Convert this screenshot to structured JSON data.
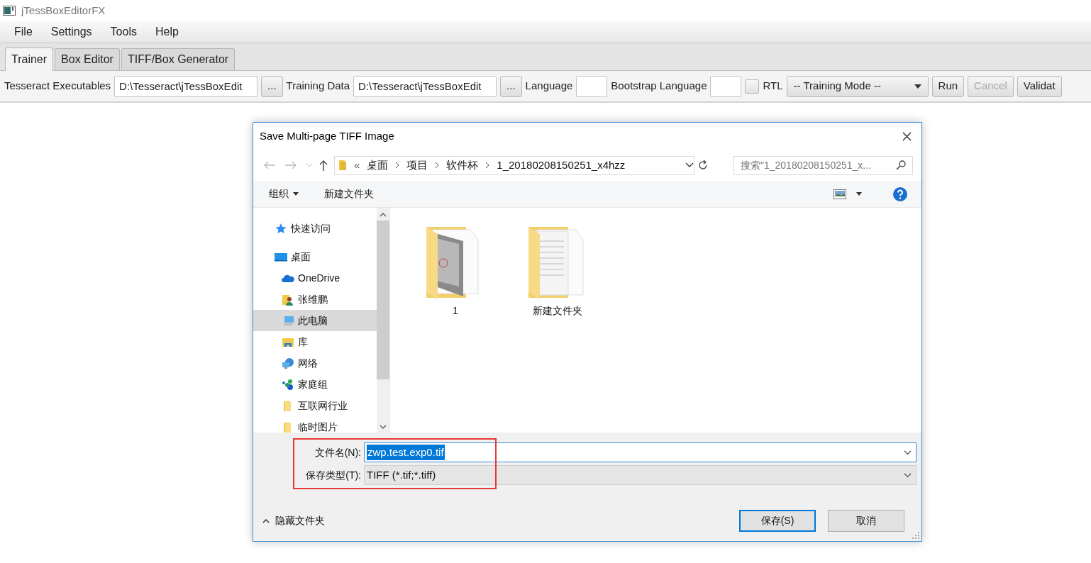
{
  "window": {
    "title": "jTessBoxEditorFX"
  },
  "menu": [
    "File",
    "Settings",
    "Tools",
    "Help"
  ],
  "tabs": [
    {
      "label": "Trainer",
      "selected": true
    },
    {
      "label": "Box Editor",
      "selected": false
    },
    {
      "label": "TIFF/Box Generator",
      "selected": false
    }
  ],
  "toolbar": [
    {
      "kind": "label",
      "text": "Tesseract Executables"
    },
    {
      "kind": "field",
      "value": "D:\\Tesseract\\jTessBoxEdit"
    },
    {
      "kind": "button",
      "text": "...",
      "disabled": false
    },
    {
      "kind": "label",
      "text": "Training Data"
    },
    {
      "kind": "field",
      "value": "D:\\Tesseract\\jTessBoxEdit"
    },
    {
      "kind": "button",
      "text": "...",
      "disabled": false
    },
    {
      "kind": "label",
      "text": "Language"
    },
    {
      "kind": "field"
    },
    {
      "kind": "label",
      "text": "Bootstrap Language"
    },
    {
      "kind": "field"
    },
    {
      "kind": "checkbox",
      "checked": false
    },
    {
      "kind": "label",
      "text": "RTL"
    },
    {
      "kind": "select",
      "text": "-- Training Mode --"
    },
    {
      "kind": "button",
      "text": "Run",
      "disabled": false
    },
    {
      "kind": "button",
      "text": "Cancel",
      "disabled": true
    },
    {
      "kind": "button",
      "text": "Validat",
      "disabled": false
    }
  ],
  "dialog": {
    "title": "Save Multi-page TIFF Image",
    "breadcrumb": [
      "«",
      "桌面",
      "项目",
      "软件杯",
      "1_20180208150251_x4hzz"
    ],
    "search": {
      "placeholder": "搜索\"1_20180208150251_x..."
    },
    "commands": [
      "组织",
      "新建文件夹"
    ],
    "nav": [
      {
        "kind": "star",
        "label": "快速访问",
        "selected": false
      },
      {
        "kind": "desktop",
        "label": "桌面",
        "selected": false
      },
      {
        "kind": "cloud",
        "label": "OneDrive",
        "selected": false
      },
      {
        "kind": "user",
        "label": "张维鹏",
        "selected": false
      },
      {
        "kind": "pc",
        "label": "此电脑",
        "selected": true
      },
      {
        "kind": "library",
        "label": "库",
        "selected": false
      },
      {
        "kind": "network",
        "label": "网络",
        "selected": false
      },
      {
        "kind": "homegroup",
        "label": "家庭组",
        "selected": false
      },
      {
        "kind": "folder",
        "label": "互联网行业",
        "selected": false
      },
      {
        "kind": "folder",
        "label": "临时图片",
        "selected": false
      }
    ],
    "files": [
      {
        "kind": "photo-folder",
        "name": "1"
      },
      {
        "kind": "doc-folder",
        "name": "新建文件夹"
      }
    ],
    "file_name": {
      "label": "文件名(N):",
      "value": "zwp.test.exp0.tif"
    },
    "file_type": {
      "label": "保存类型(T):",
      "value": "TIFF (*.tif;*.tiff)"
    },
    "hide_folders": "隐藏文件夹",
    "buttons": [
      {
        "text": "保存(S)",
        "default": true
      },
      {
        "text": "取消",
        "default": false
      }
    ],
    "highlight_box": true
  }
}
